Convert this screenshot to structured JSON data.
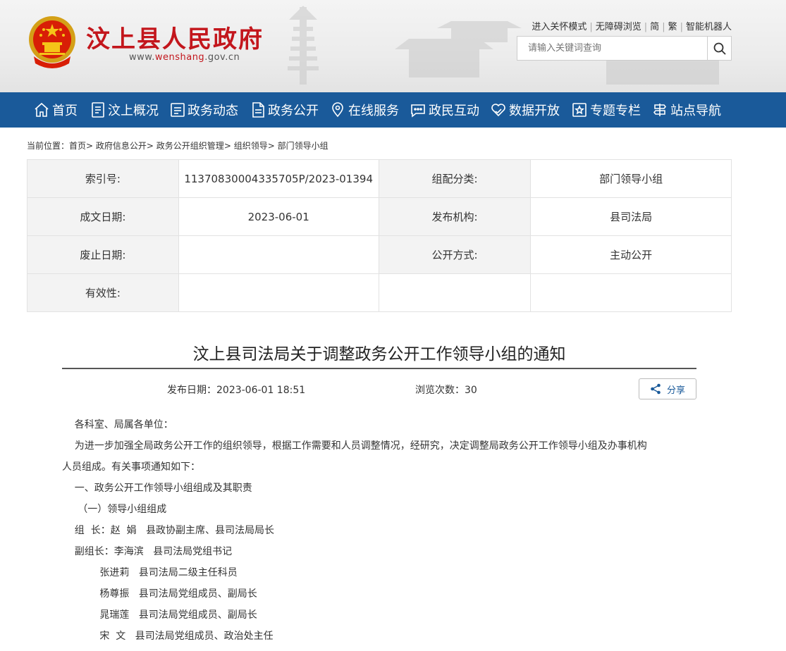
{
  "header": {
    "site_title": "汶上县人民政府",
    "url_prefix": "www.",
    "url_brand": "wenshang",
    "url_suffix": ".gov.cn",
    "top_links": [
      "进入关怀模式",
      "无障碍浏览",
      "简",
      "繁",
      "智能机器人"
    ],
    "search_placeholder": "请输入关键词查询"
  },
  "nav": [
    {
      "label": "首页",
      "icon": "home-icon"
    },
    {
      "label": "汶上概况",
      "icon": "document-list-icon"
    },
    {
      "label": "政务动态",
      "icon": "news-icon"
    },
    {
      "label": "政务公开",
      "icon": "file-icon"
    },
    {
      "label": "在线服务",
      "icon": "location-icon"
    },
    {
      "label": "政民互动",
      "icon": "chat-icon"
    },
    {
      "label": "数据开放",
      "icon": "heart-hand-icon"
    },
    {
      "label": "专题专栏",
      "icon": "star-box-icon"
    },
    {
      "label": "站点导航",
      "icon": "signpost-icon"
    }
  ],
  "breadcrumb": {
    "prefix": "当前位置：",
    "items": [
      "首页",
      "政府信息公开",
      "政务公开组织管理",
      "组织领导",
      "部门领导小组"
    ]
  },
  "info_table": [
    [
      "索引号:",
      "11370830004335705P/2023-01394",
      "组配分类:",
      "部门领导小组"
    ],
    [
      "成文日期:",
      "2023-06-01",
      "发布机构:",
      "县司法局"
    ],
    [
      "废止日期:",
      "",
      "公开方式:",
      "主动公开"
    ],
    [
      "有效性:",
      "",
      "",
      ""
    ]
  ],
  "article": {
    "title": "汶上县司法局关于调整政务公开工作领导小组的通知",
    "publish_label": "发布日期：",
    "publish_date": "2023-06-01 18:51",
    "views_label": "浏览次数：",
    "views": "30",
    "share_label": "分享",
    "paragraphs": [
      "    各科室、局属各单位：",
      "    为进一步加强全局政务公开工作的组织领导，根据工作需要和人员调整情况，经研究，决定调整局政务公开工作领导小组及办事机构",
      "人员组成。有关事项通知如下：",
      "    一、政务公开工作领导小组组成及其职责",
      "     （一）领导小组组成",
      "    组  长：赵  娟   县政协副主席、县司法局局长",
      "    副组长：李海滨   县司法局党组书记",
      "            张进莉   县司法局二级主任科员",
      "            杨尊振   县司法局党组成员、副局长",
      "            晁瑞莲   县司法局党组成员、副局长",
      "            宋  文   县司法局党组成员、政治处主任"
    ]
  },
  "colors": {
    "nav_bg": "#1a5a9a",
    "title_red": "#c3161c"
  }
}
